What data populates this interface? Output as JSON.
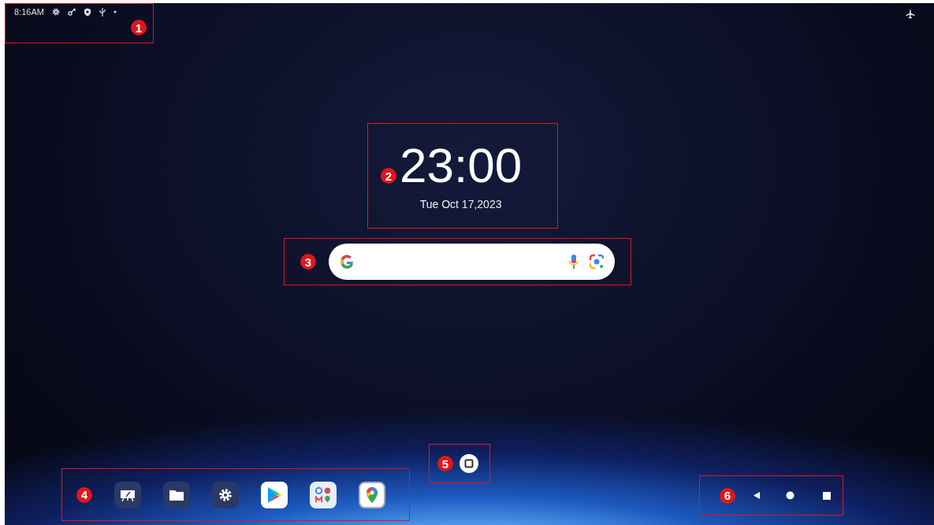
{
  "status_bar": {
    "time": "8:16AM"
  },
  "clock": {
    "time": "23:00",
    "date": "Tue Oct 17,2023"
  },
  "callouts": [
    "1",
    "2",
    "3",
    "4",
    "5",
    "6"
  ]
}
